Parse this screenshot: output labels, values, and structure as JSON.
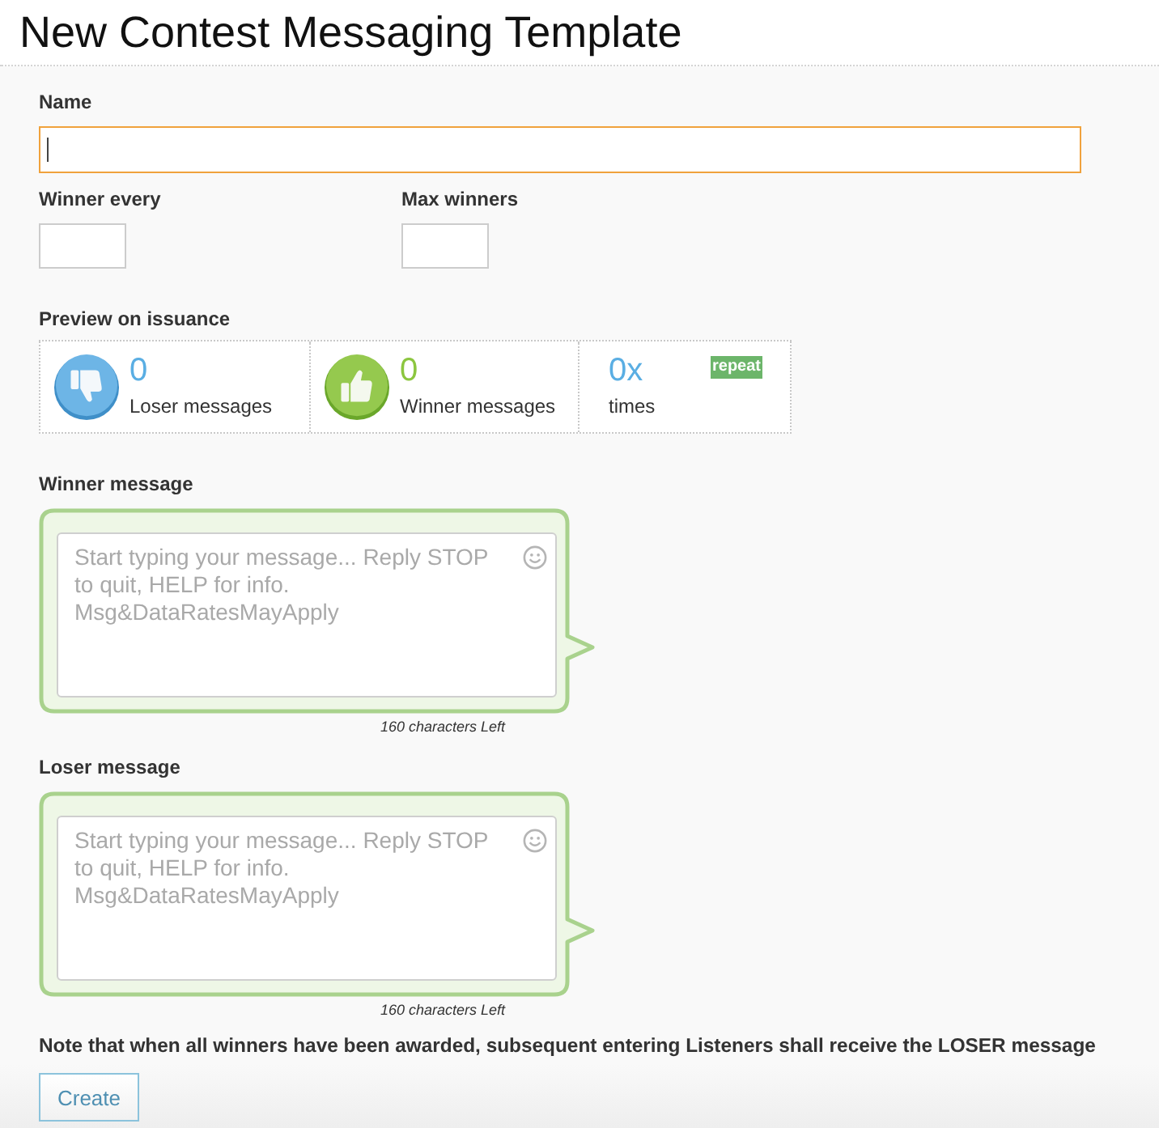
{
  "title": "New Contest Messaging Template",
  "form": {
    "name": {
      "label": "Name",
      "focused": true
    },
    "winner_every": {
      "label": "Winner every"
    },
    "max_winners": {
      "label": "Max winners"
    }
  },
  "preview": {
    "label": "Preview on issuance",
    "stats": [
      {
        "kind": "loser",
        "count": "0",
        "caption": "Loser messages"
      },
      {
        "kind": "winner",
        "count": "0",
        "caption": "Winner messages"
      },
      {
        "kind": "repeat",
        "count": "0x",
        "caption": "times",
        "badge": "repeat"
      }
    ]
  },
  "messages": [
    {
      "label": "Winner message",
      "placeholder": "Start typing your message... Reply STOP to quit, HELP for info. Msg&DataRatesMayApply",
      "counter": "160 characters Left"
    },
    {
      "label": "Loser message",
      "placeholder": "Start typing your message... Reply STOP to quit, HELP for info. Msg&DataRatesMayApply",
      "counter": "160 characters Left"
    }
  ],
  "note": "Note that when all winners have been awarded, subsequent entering Listeners shall receive the LOSER message",
  "buttons": [
    {
      "label": "Create"
    }
  ]
}
